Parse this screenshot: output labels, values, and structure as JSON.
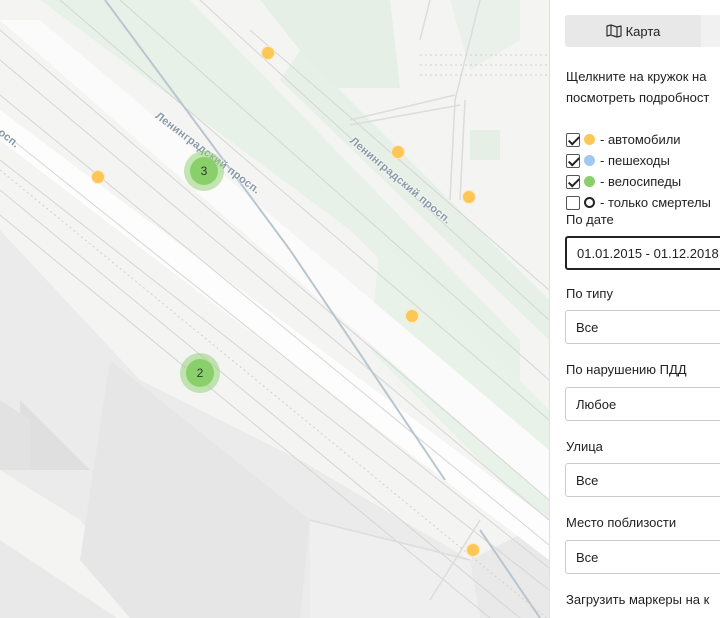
{
  "map": {
    "road_labels": [
      "Ленинградский просп.",
      "Ленинградский просп.",
      "просп."
    ],
    "clusters": [
      {
        "count": "3"
      },
      {
        "count": "2"
      }
    ],
    "marker_color": "#fcc757",
    "cluster_color": "#8ad06a"
  },
  "tabs": {
    "map_label": "Карта",
    "map_icon": "map-icon"
  },
  "hint": {
    "line1": "Щелкните на кружок на",
    "line2": "посмотреть подробност"
  },
  "legend": [
    {
      "label": "- автомобили",
      "checked": true,
      "color": "#fcc757"
    },
    {
      "label": "- пешеходы",
      "checked": true,
      "color": "#9ec9f2"
    },
    {
      "label": "- велосипеды",
      "checked": true,
      "color": "#8ad06a"
    },
    {
      "label": "- только смертелы",
      "checked": false,
      "color": "ring"
    }
  ],
  "filters": {
    "date_label": "По дате",
    "date_value": "01.01.2015 - 01.12.2018",
    "type_label": "По типу",
    "type_value": "Все",
    "violation_label": "По нарушению ПДД",
    "violation_value": "Любое",
    "street_label": "Улица",
    "street_value": "Все",
    "nearby_label": "Место поблизости",
    "nearby_value": "Все",
    "load_label": "Загрузить маркеры на к"
  }
}
